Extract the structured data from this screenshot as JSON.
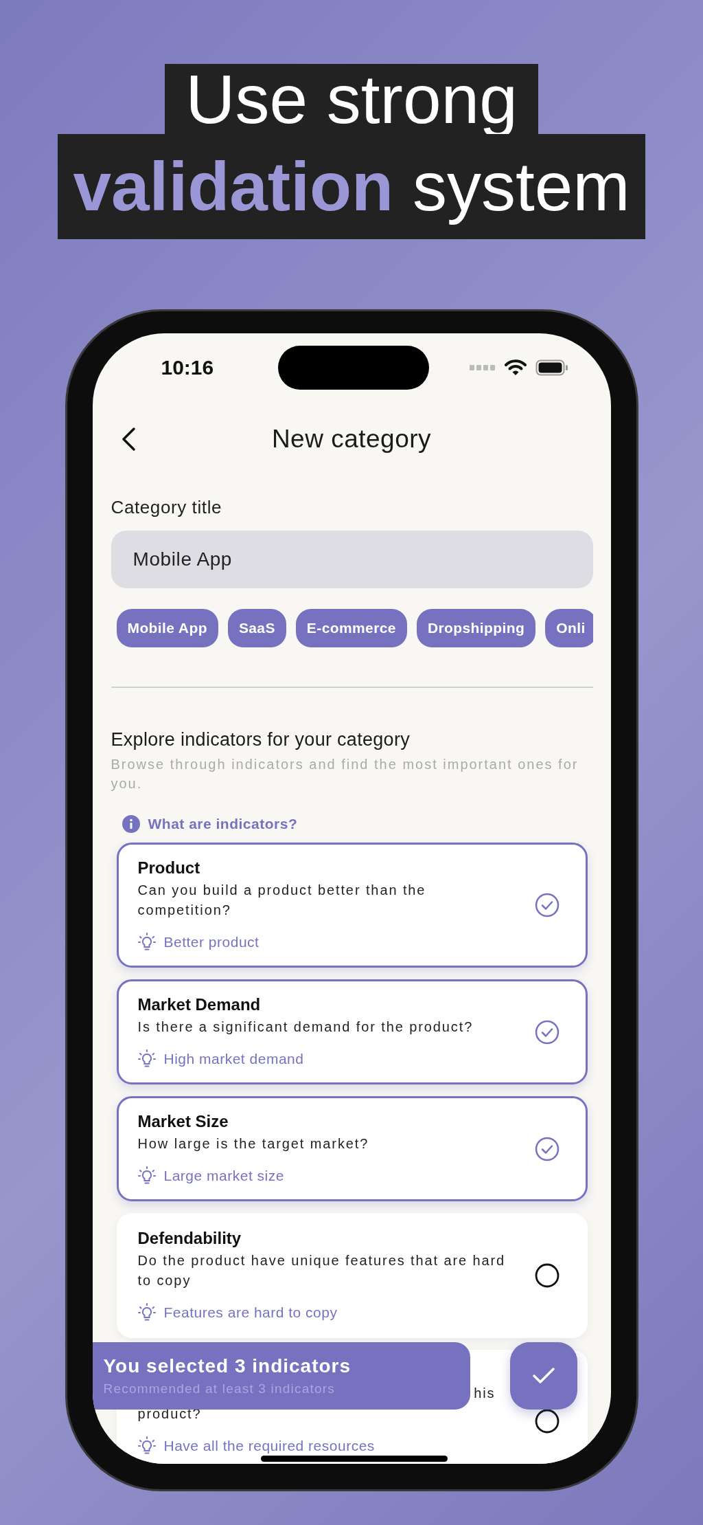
{
  "headline": {
    "lines": [
      "Use strong",
      "**validation** system"
    ]
  },
  "status_bar": {
    "time": "10:16"
  },
  "nav": {
    "title": "New category"
  },
  "category_title": {
    "label": "Category title",
    "value": "Mobile App"
  },
  "suggestions": [
    "Mobile App",
    "SaaS",
    "E-commerce",
    "Dropshipping",
    "Onli"
  ],
  "indicators_section": {
    "title": "Explore indicators for your category",
    "subtitle": "Browse through indicators and find the most important ones for you.",
    "help_link": "What are indicators?"
  },
  "cards": [
    {
      "kind": "full",
      "title": "Product",
      "description": "Can you build a product better than the competition?",
      "hint": "Better product",
      "selected": true
    },
    {
      "kind": "full",
      "title": "Market Demand",
      "description": "Is there a significant demand for the product?",
      "hint": "High market demand",
      "selected": true
    },
    {
      "kind": "full",
      "title": "Market Size",
      "description": "How large is the target market?",
      "hint": "Large market size",
      "selected": true
    },
    {
      "kind": "full",
      "title": "Defendability",
      "description": "Do the product have unique features that are hard to copy",
      "hint": "Features are hard to copy",
      "selected": false
    },
    {
      "kind": "covered",
      "fragments": [
        "his",
        "product?"
      ],
      "hint": "Have all the required resources",
      "selected": false
    }
  ],
  "toast": {
    "title": "You selected 3 indicators",
    "subtitle": "Recommended at least 3 indicators"
  }
}
